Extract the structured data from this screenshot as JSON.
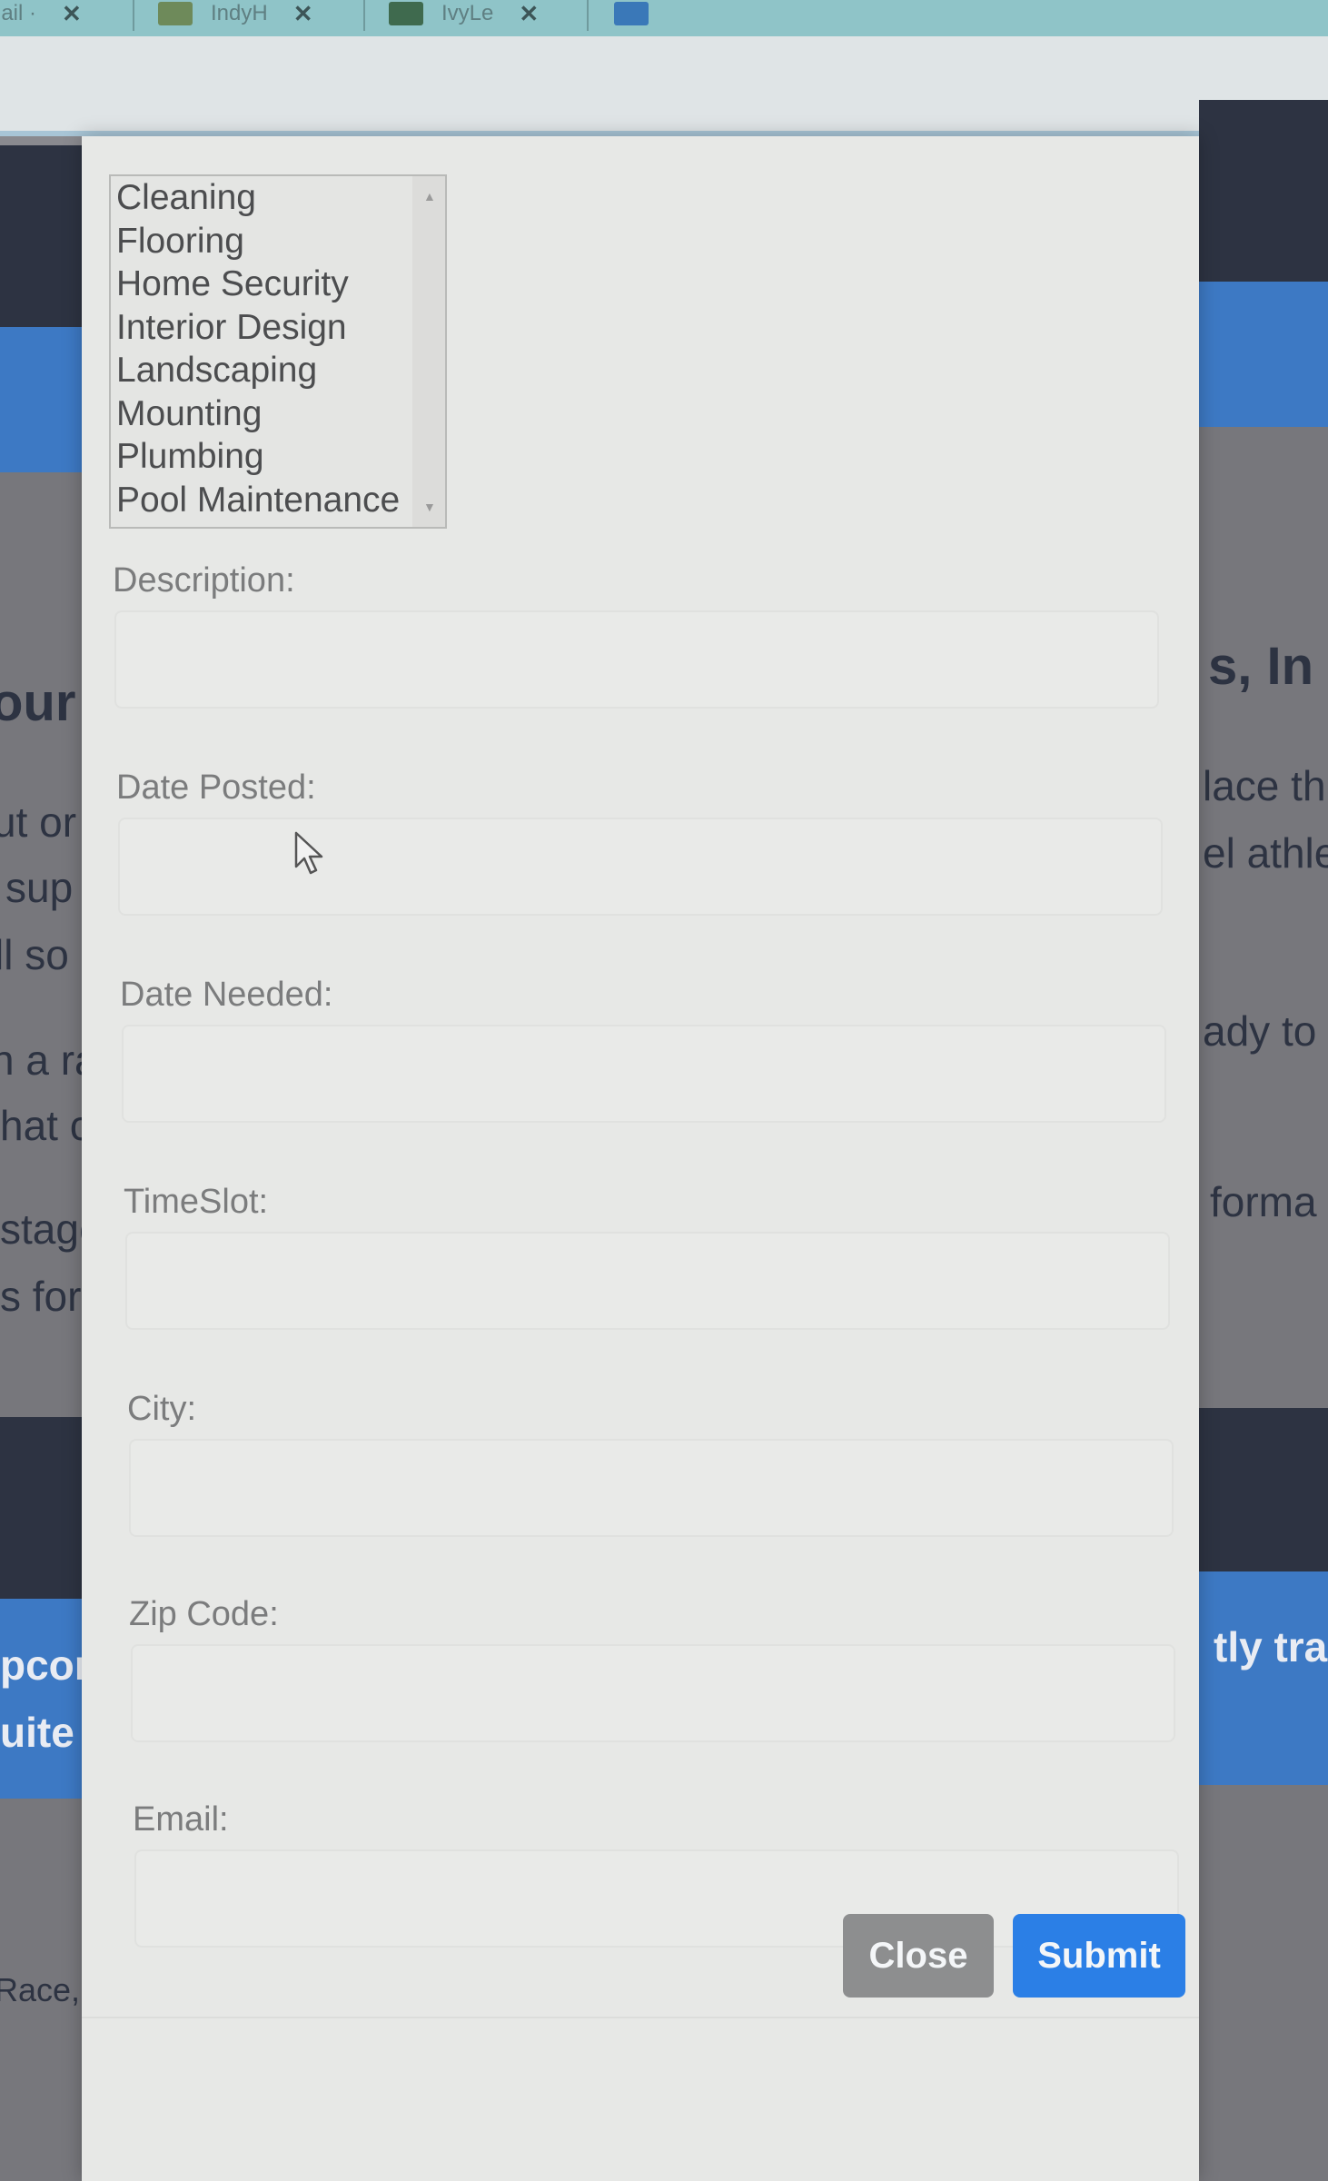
{
  "browser": {
    "tabs": [
      {
        "label": "lail ·",
        "close": "✕"
      },
      {
        "label": "IndyH",
        "close": "✕"
      },
      {
        "label": "IvyLe",
        "close": "✕"
      }
    ]
  },
  "background": {
    "left_snippets": [
      "our",
      "ut or",
      "sup",
      "ll so",
      "n a ra",
      "hat c",
      "stage",
      "s for",
      "pcon",
      "uite",
      "Race,"
    ],
    "right_snippets": [
      "s, In",
      "lace th",
      "el athle",
      "ady to",
      "forma",
      "tly tra"
    ]
  },
  "modal": {
    "category_options": [
      "Cleaning",
      "Flooring",
      "Home Security",
      "Interior Design",
      "Landscaping",
      "Mounting",
      "Plumbing",
      "Pool Maintenance"
    ],
    "fields": {
      "description": {
        "label": "Description:",
        "value": ""
      },
      "date_posted": {
        "label": "Date Posted:",
        "value": ""
      },
      "date_needed": {
        "label": "Date Needed:",
        "value": ""
      },
      "timeslot": {
        "label": "TimeSlot:",
        "value": ""
      },
      "city": {
        "label": "City:",
        "value": ""
      },
      "zip": {
        "label": "Zip Code:",
        "value": ""
      },
      "email": {
        "label": "Email:",
        "value": ""
      }
    },
    "buttons": {
      "close": "Close",
      "submit": "Submit"
    }
  },
  "colors": {
    "submit": "#2b7fe6",
    "close": "#8d8e8f",
    "header_dark": "#2d3342",
    "header_blue": "#3d79c4"
  }
}
